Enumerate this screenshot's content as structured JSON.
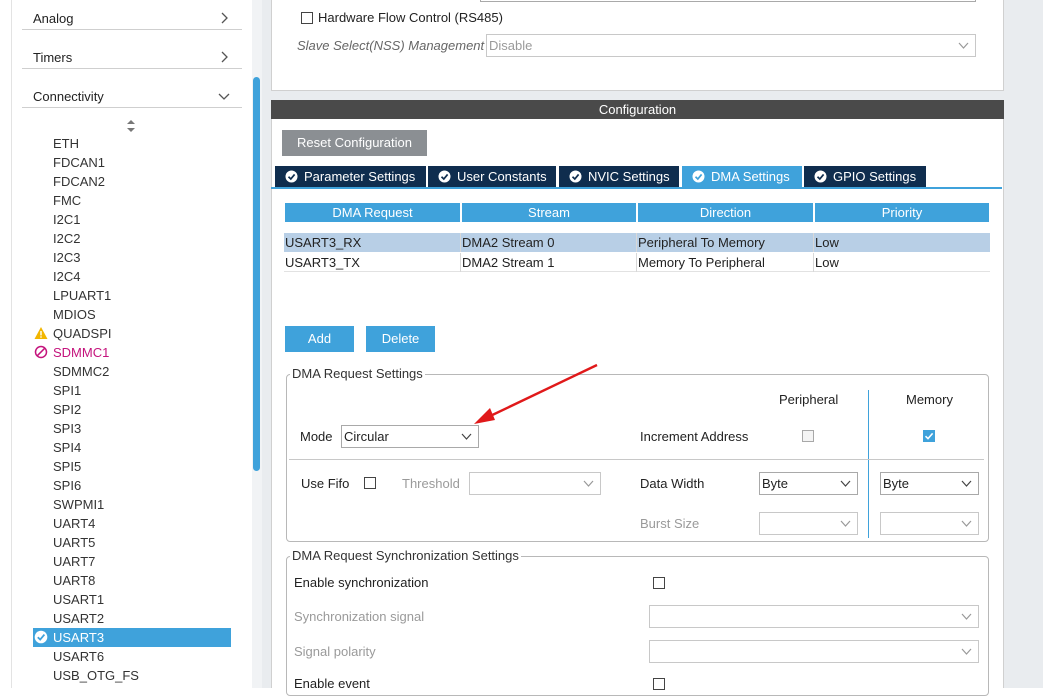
{
  "sidebar": {
    "categories": [
      {
        "label": "Analog",
        "state": "collapsed"
      },
      {
        "label": "Timers",
        "state": "collapsed"
      },
      {
        "label": "Connectivity",
        "state": "expanded"
      }
    ],
    "peripherals": [
      {
        "label": "ETH",
        "status": ""
      },
      {
        "label": "FDCAN1",
        "status": ""
      },
      {
        "label": "FDCAN2",
        "status": ""
      },
      {
        "label": "FMC",
        "status": ""
      },
      {
        "label": "I2C1",
        "status": ""
      },
      {
        "label": "I2C2",
        "status": ""
      },
      {
        "label": "I2C3",
        "status": ""
      },
      {
        "label": "I2C4",
        "status": ""
      },
      {
        "label": "LPUART1",
        "status": ""
      },
      {
        "label": "MDIOS",
        "status": ""
      },
      {
        "label": "QUADSPI",
        "status": "warning"
      },
      {
        "label": "SDMMC1",
        "status": "error"
      },
      {
        "label": "SDMMC2",
        "status": ""
      },
      {
        "label": "SPI1",
        "status": ""
      },
      {
        "label": "SPI2",
        "status": ""
      },
      {
        "label": "SPI3",
        "status": ""
      },
      {
        "label": "SPI4",
        "status": ""
      },
      {
        "label": "SPI5",
        "status": ""
      },
      {
        "label": "SPI6",
        "status": ""
      },
      {
        "label": "SWPMI1",
        "status": ""
      },
      {
        "label": "UART4",
        "status": ""
      },
      {
        "label": "UART5",
        "status": ""
      },
      {
        "label": "UART7",
        "status": ""
      },
      {
        "label": "UART8",
        "status": ""
      },
      {
        "label": "USART1",
        "status": ""
      },
      {
        "label": "USART2",
        "status": ""
      },
      {
        "label": "USART3",
        "status": "selected"
      },
      {
        "label": "USART6",
        "status": ""
      },
      {
        "label": "USB_OTG_FS",
        "status": ""
      }
    ]
  },
  "top_section": {
    "hw_flow_label": "Hardware Flow Control (RS485)",
    "slave_select_label": "Slave Select(NSS) Management",
    "slave_select_value": "Disable"
  },
  "configuration": {
    "title": "Configuration",
    "reset_button": "Reset Configuration",
    "tabs": [
      {
        "label": "Parameter Settings",
        "active": false
      },
      {
        "label": "User Constants",
        "active": false
      },
      {
        "label": "NVIC Settings",
        "active": false
      },
      {
        "label": "DMA Settings",
        "active": true
      },
      {
        "label": "GPIO Settings",
        "active": false
      }
    ],
    "dma_table": {
      "columns": [
        "DMA Request",
        "Stream",
        "Direction",
        "Priority"
      ],
      "rows": [
        [
          "USART3_RX",
          "DMA2 Stream 0",
          "Peripheral To Memory",
          "Low"
        ],
        [
          "USART3_TX",
          "DMA2 Stream 1",
          "Memory To Peripheral",
          "Low"
        ]
      ],
      "selected_row": 0
    },
    "add_button": "Add",
    "delete_button": "Delete",
    "request_settings": {
      "group_label": "DMA Request Settings",
      "peripheral_header": "Peripheral",
      "memory_header": "Memory",
      "mode_label": "Mode",
      "mode_value": "Circular",
      "increment_label": "Increment Address",
      "increment_peripheral": false,
      "increment_memory": true,
      "use_fifo_label": "Use Fifo",
      "threshold_label": "Threshold",
      "data_width_label": "Data Width",
      "data_width_peripheral": "Byte",
      "data_width_memory": "Byte",
      "burst_size_label": "Burst Size"
    },
    "sync_settings": {
      "group_label": "DMA Request Synchronization Settings",
      "enable_sync_label": "Enable synchronization",
      "sync_signal_label": "Synchronization signal",
      "signal_polarity_label": "Signal polarity",
      "enable_event_label": "Enable event"
    }
  },
  "colors": {
    "accent": "#3fa2db",
    "tab_dark": "#0f2d4e",
    "warning": "#f2b600",
    "error": "#c4137c",
    "annotation_arrow": "#e0191a"
  }
}
